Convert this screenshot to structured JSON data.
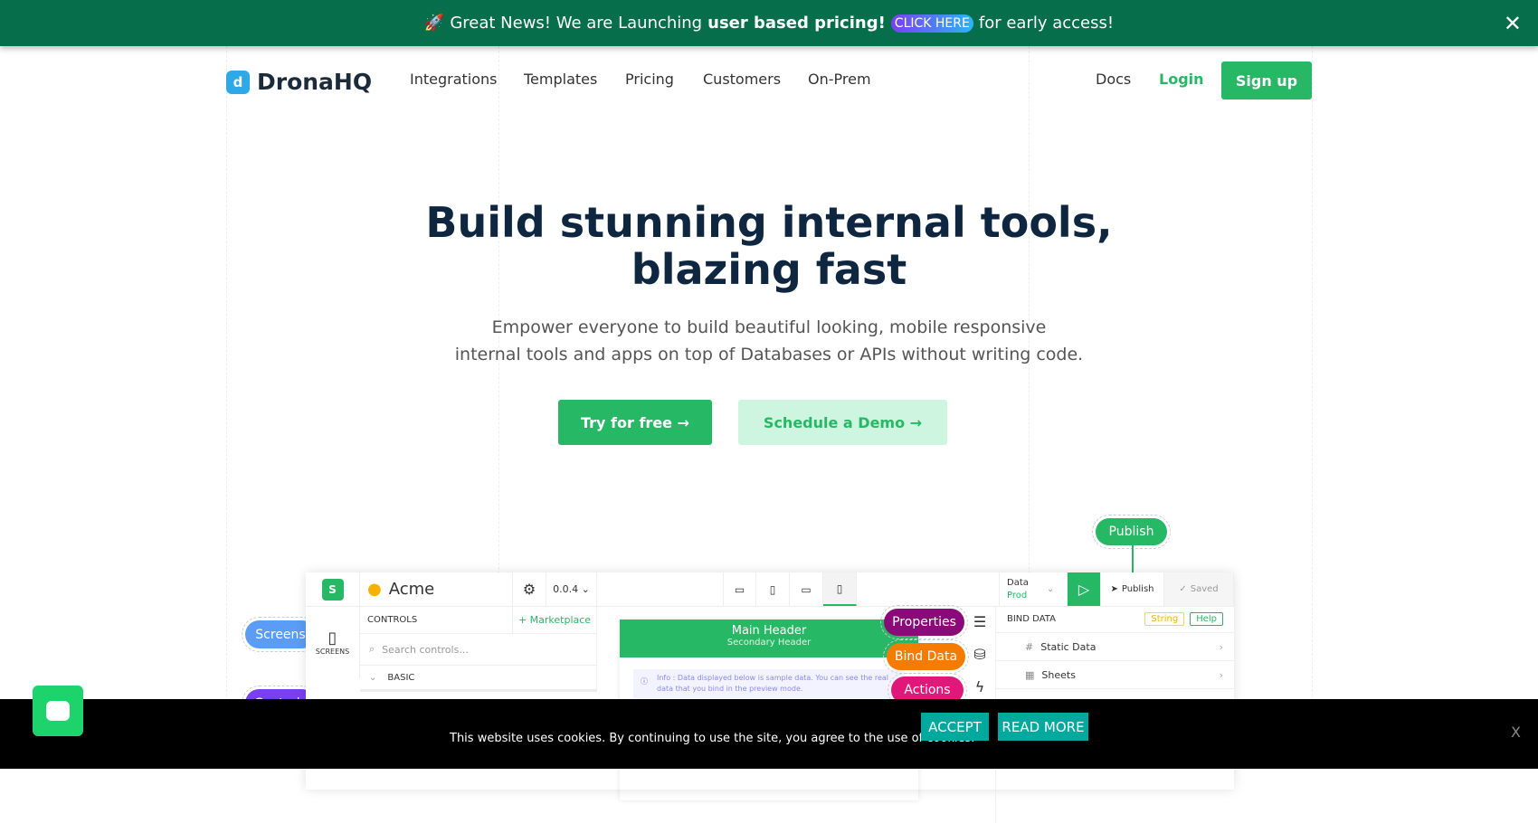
{
  "banner": {
    "emoji": "🚀",
    "text_before": "Great News! We are Launching",
    "bold": "user based pricing!",
    "cta": "CLICK HERE",
    "text_after": "for early access!",
    "close": "✕"
  },
  "nav": {
    "brand": "DronaHQ",
    "items": [
      "Integrations",
      "Templates",
      "Pricing",
      "Customers",
      "On-Prem"
    ],
    "docs": "Docs",
    "login": "Login",
    "signup": "Sign up"
  },
  "hero": {
    "title_line1": "Build stunning internal tools,",
    "title_line2": "blazing fast",
    "subtitle_line1": "Empower everyone to build beautiful looking, mobile responsive",
    "subtitle_line2": "internal tools and apps on top of Databases or APIs without writing code.",
    "try": "Try for free →",
    "demo": "Schedule a Demo →"
  },
  "mockup": {
    "app_name": "Acme",
    "version": "0.0.4",
    "screens_label": "SCREENS",
    "controls": "CONTROLS",
    "marketplace": "+ Marketplace",
    "search_placeholder": "Search controls...",
    "basic": "BASIC",
    "main_header": "Main Header",
    "secondary_header": "Secondary Header",
    "info": "Info : Data displayed below is sample data. You can see the real data that you bind in the preview mode.",
    "data_label": "Data",
    "data_env": "Prod",
    "publish": "Publish",
    "saved": "Saved",
    "bind_data": "BIND DATA",
    "string": "String",
    "help": "Help",
    "rows": [
      "Static Data",
      "Sheets"
    ]
  },
  "callouts": {
    "publish": "Publish",
    "screens": "Screens",
    "controls": "Controls",
    "properties": "Properties",
    "bind_data": "Bind Data",
    "actions": "Actions"
  },
  "cookie": {
    "text": "This website uses cookies. By continuing to use the site, you agree to the use of cookies.",
    "accept": "ACCEPT",
    "read_more": "READ MORE",
    "close": "X"
  },
  "colors": {
    "banner": "#066e4a",
    "primary": "#27b865",
    "properties": "#8b0a7a",
    "bind_data": "#f57c00",
    "actions": "#e0187a",
    "screens": "#5b9cf6",
    "accept": "#00a99d"
  }
}
